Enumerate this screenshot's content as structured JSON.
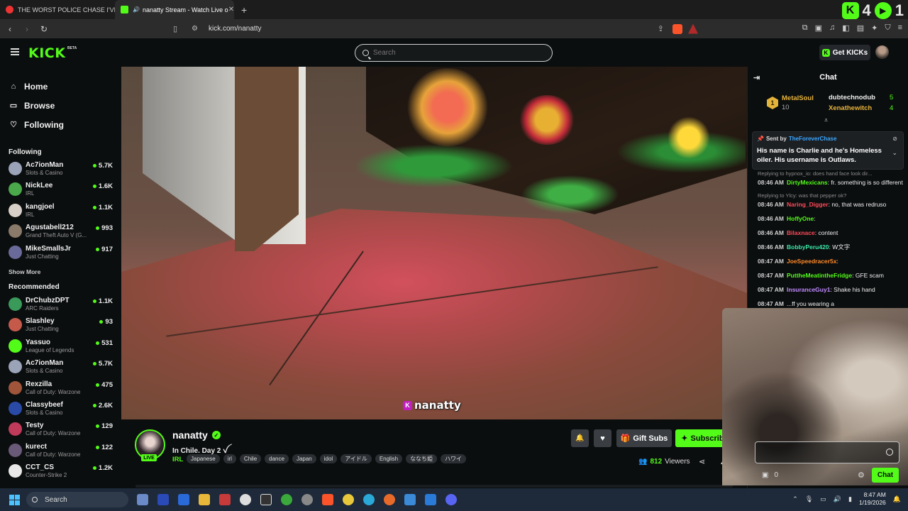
{
  "browser": {
    "tabs": [
      {
        "title": "THE WORST POLICE CHASE I'VE EVER",
        "active": false
      },
      {
        "title": "nanatty Stream - Watch Live o",
        "active": true
      }
    ],
    "url": "kick.com/nanatty",
    "extension_counts": [
      "4",
      "1"
    ]
  },
  "header": {
    "logo": "KICK",
    "beta": "BETA",
    "search_placeholder": "Search",
    "get_kicks": "Get KICKs"
  },
  "sidebar": {
    "nav": [
      {
        "label": "Home",
        "icon": "home-icon"
      },
      {
        "label": "Browse",
        "icon": "browse-icon"
      },
      {
        "label": "Following",
        "icon": "heart-icon"
      }
    ],
    "following_title": "Following",
    "following": [
      {
        "name": "Ac7ionMan",
        "category": "Slots & Casino",
        "viewers": "5.7K",
        "color": "#9aa3b8"
      },
      {
        "name": "NickLee",
        "category": "IRL",
        "viewers": "1.6K",
        "color": "#4aa84a"
      },
      {
        "name": "kangjoel",
        "category": "IRL",
        "viewers": "1.1K",
        "color": "#d8d0c8"
      },
      {
        "name": "Agustabell212",
        "category": "Grand Theft Auto V (G...",
        "viewers": "993",
        "color": "#8a7a6a"
      },
      {
        "name": "MikeSmallsJr",
        "category": "Just Chatting",
        "viewers": "917",
        "color": "#6a6a9a"
      }
    ],
    "show_more": "Show More",
    "recommended_title": "Recommended",
    "recommended": [
      {
        "name": "DrChubzDPT",
        "category": "ARC Raiders",
        "viewers": "1.1K",
        "color": "#3a9a5a"
      },
      {
        "name": "Slashley",
        "category": "Just Chatting",
        "viewers": "93",
        "color": "#c55a4a"
      },
      {
        "name": "Yassuo",
        "category": "League of Legends",
        "viewers": "531",
        "color": "#53fc18"
      },
      {
        "name": "Ac7ionMan",
        "category": "Slots & Casino",
        "viewers": "5.7K",
        "color": "#9aa3b8"
      },
      {
        "name": "Rexzilla",
        "category": "Call of Duty: Warzone",
        "viewers": "475",
        "color": "#a0553a"
      },
      {
        "name": "Classybeef",
        "category": "Slots & Casino",
        "viewers": "2.6K",
        "color": "#2a4aa8"
      },
      {
        "name": "Testy",
        "category": "Call of Duty: Warzone",
        "viewers": "129",
        "color": "#c03a5a"
      },
      {
        "name": "kurect",
        "category": "Call of Duty: Warzone",
        "viewers": "122",
        "color": "#6a5a7a"
      },
      {
        "name": "CCT_CS",
        "category": "Counter-Strike 2",
        "viewers": "1.2K",
        "color": "#e8e8e8"
      }
    ]
  },
  "video": {
    "watermark": "nanatty"
  },
  "stream": {
    "name": "nanatty",
    "live": "LIVE",
    "title": "In Chile. Day 2 ꪜ",
    "category": "IRL",
    "tags": [
      "Japanese",
      "irl",
      "Chile",
      "dance",
      "Japan",
      "idol",
      "アイドル",
      "English",
      "ななち姫",
      "ハワイ"
    ],
    "gift_subs": "Gift Subs",
    "subscribe": "Subscribe",
    "viewers": "812",
    "viewers_label": "Viewers"
  },
  "chat": {
    "title": "Chat",
    "leaderboard": {
      "rank": "1",
      "top": {
        "name": "MetalSoul",
        "count": "10"
      },
      "second": {
        "name": "dubtechnodub",
        "count": "5"
      },
      "third": {
        "name": "Xenathewitch",
        "count": "4"
      }
    },
    "pinned": {
      "sent_by": "Sent by",
      "user": "TheForeverChase",
      "message": "His name is Charlie and he's Homeless oiler. His username is Outlaws."
    },
    "messages": [
      {
        "reply": "Replying to hypnox_io: does hand face look dir...",
        "time": "08:46 AM",
        "user": "DirtyMexicans",
        "color": "#53fc18",
        "text": ": fr. something is so different"
      },
      {
        "reply": "Replying to Ylcy: was that pepper ok?",
        "time": "08:46 AM",
        "user": "Naring_Digger",
        "color": "#ff4a5a",
        "text": ": no, that was redruso"
      },
      {
        "reply": "",
        "time": "08:46 AM",
        "user": "HoffyOne",
        "color": "#53fc18",
        "text": ":"
      },
      {
        "reply": "",
        "time": "08:46 AM",
        "user": "Bilaxnace",
        "color": "#ff4a5a",
        "text": ": content"
      },
      {
        "reply": "",
        "time": "08:46 AM",
        "user": "BobbyPeru420",
        "color": "#3ae8a8",
        "text": ": W文字"
      },
      {
        "reply": "",
        "time": "08:47 AM",
        "user": "JoeSpeedracer5x",
        "color": "#ff8a2a",
        "text": ":"
      },
      {
        "reply": "",
        "time": "08:47 AM",
        "user": "PuttheMeatintheFridge",
        "color": "#53fc18",
        "text": ": GFE scam"
      },
      {
        "reply": "",
        "time": "08:47 AM",
        "user": "InsuranceGuy1",
        "color": "#c08aff",
        "text": ": Shake his hand"
      },
      {
        "reply": "",
        "time": "08:47 AM",
        "user": "",
        "color": "#ddd",
        "text": "...ff you wearing a"
      }
    ],
    "points": "0",
    "send": "Chat"
  },
  "taskbar": {
    "search": "Search",
    "time": "8:47 AM",
    "date": "1/19/2026"
  }
}
